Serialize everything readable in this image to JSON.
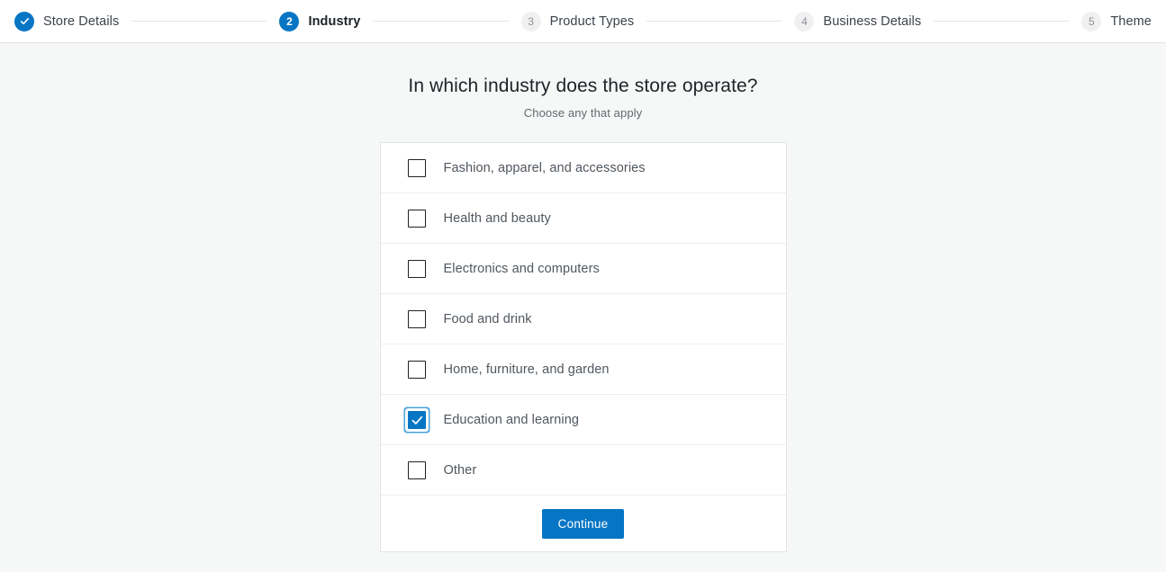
{
  "stepper": {
    "steps": [
      {
        "number": "1",
        "label": "Store Details",
        "state": "complete",
        "icon": "check-icon"
      },
      {
        "number": "2",
        "label": "Industry",
        "state": "current",
        "icon": ""
      },
      {
        "number": "3",
        "label": "Product Types",
        "state": "upcoming",
        "icon": ""
      },
      {
        "number": "4",
        "label": "Business Details",
        "state": "upcoming",
        "icon": ""
      },
      {
        "number": "5",
        "label": "Theme",
        "state": "upcoming",
        "icon": ""
      }
    ]
  },
  "main": {
    "title": "In which industry does the store operate?",
    "subtitle": "Choose any that apply",
    "options": [
      {
        "label": "Fashion, apparel, and accessories",
        "checked": false
      },
      {
        "label": "Health and beauty",
        "checked": false
      },
      {
        "label": "Electronics and computers",
        "checked": false
      },
      {
        "label": "Food and drink",
        "checked": false
      },
      {
        "label": "Home, furniture, and garden",
        "checked": false
      },
      {
        "label": "Education and learning",
        "checked": true
      },
      {
        "label": "Other",
        "checked": false
      }
    ],
    "continue_label": "Continue"
  },
  "colors": {
    "accent": "#0675c4",
    "focus_ring": "#4aa3dc",
    "page_background": "#f6f7f7",
    "card_background": "#ffffff",
    "border": "#e2e4e7",
    "text_primary": "#1d2327",
    "text_secondary": "#50575e",
    "text_muted": "#646970"
  }
}
